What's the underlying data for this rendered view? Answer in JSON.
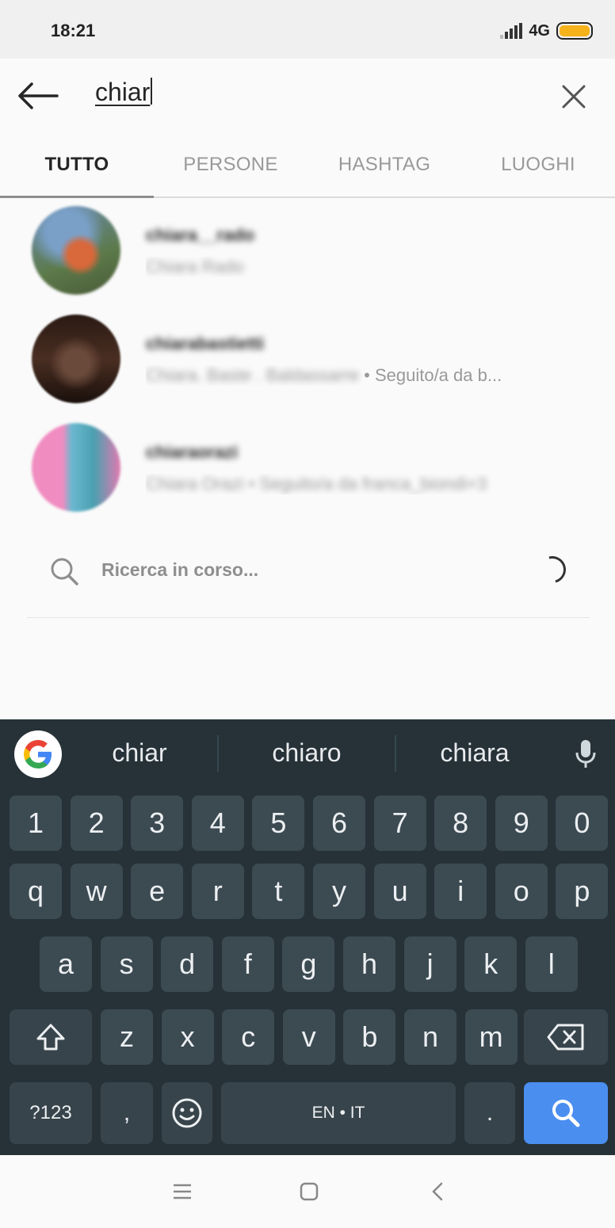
{
  "status_bar": {
    "time": "18:21",
    "network": "4G",
    "battery_color": "#f5b21a"
  },
  "search": {
    "back_icon": "arrow-left-icon",
    "query": "chiar",
    "clear_icon": "close-icon"
  },
  "tabs": [
    {
      "label": "TUTTO",
      "active": true
    },
    {
      "label": "PERSONE",
      "active": false
    },
    {
      "label": "HASHTAG",
      "active": false
    },
    {
      "label": "LUOGHI",
      "active": false
    }
  ],
  "results": [
    {
      "username": "chiara__rado",
      "meta_blurred": "Chiara Rado",
      "meta_visible": ""
    },
    {
      "username": "chiarabastietti",
      "meta_blurred": "Chiara. Baste . Baldassarre",
      "meta_visible": " • Seguito/a da b..."
    },
    {
      "username": "chiaraorazi",
      "meta_blurred": "Chiara Orazi • Seguito/a da franca_biondi+3",
      "meta_visible": ""
    }
  ],
  "searching": {
    "label": "Ricerca in corso...",
    "icon": "search-icon"
  },
  "keyboard": {
    "suggestions": [
      "chiar",
      "chiaro",
      "chiara"
    ],
    "row_numbers": [
      "1",
      "2",
      "3",
      "4",
      "5",
      "6",
      "7",
      "8",
      "9",
      "0"
    ],
    "row1": [
      "q",
      "w",
      "e",
      "r",
      "t",
      "y",
      "u",
      "i",
      "o",
      "p"
    ],
    "row2": [
      "a",
      "s",
      "d",
      "f",
      "g",
      "h",
      "j",
      "k",
      "l"
    ],
    "row3": [
      "z",
      "x",
      "c",
      "v",
      "b",
      "n",
      "m"
    ],
    "symbols_key": "?123",
    "comma_key": ",",
    "space_key": "EN • IT",
    "period_key": ".",
    "action_color": "#4a8ef0"
  },
  "navbar": {
    "buttons": [
      "menu-icon",
      "home-square-icon",
      "back-chevron-icon"
    ]
  }
}
